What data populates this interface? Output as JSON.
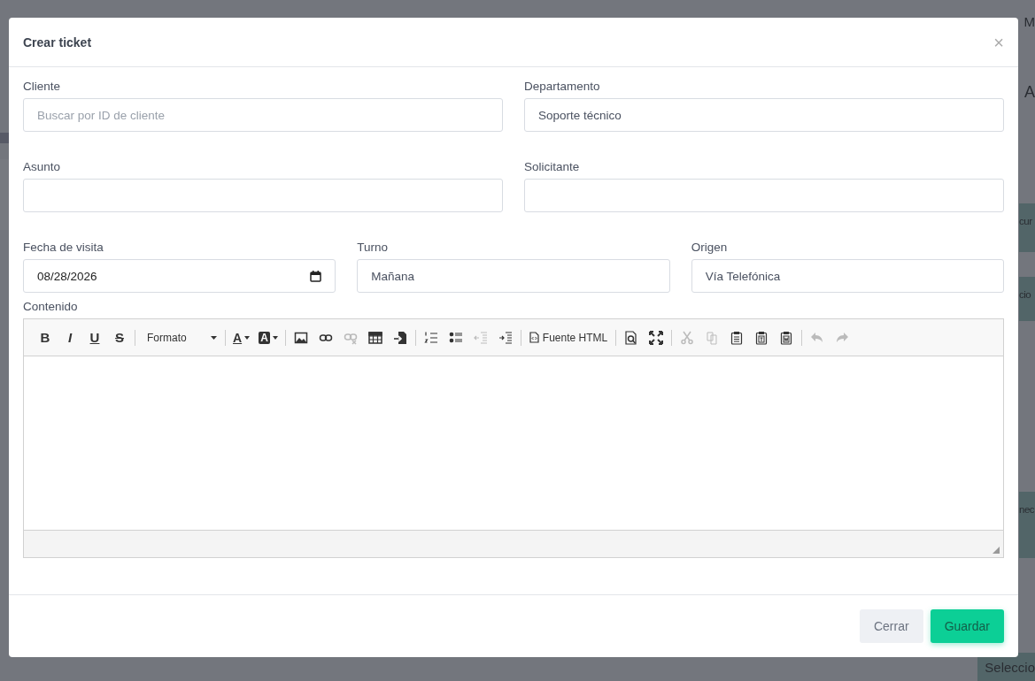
{
  "background": {
    "fragments": [
      {
        "text": "M",
        "kind": "plain"
      },
      {
        "text": "A",
        "kind": "plain"
      },
      {
        "text": "cur",
        "kind": "band"
      },
      {
        "text": "cio",
        "kind": "band"
      },
      {
        "text": "nec",
        "kind": "band"
      },
      {
        "text": "Seleccio",
        "kind": "band"
      }
    ]
  },
  "modal": {
    "title": "Crear ticket",
    "close": "×",
    "rows": [
      [
        {
          "label": "Cliente",
          "placeholder": "Buscar por ID de cliente",
          "kind": "text"
        },
        {
          "label": "Departamento",
          "value": "Soporte técnico",
          "kind": "text"
        }
      ],
      [
        {
          "label": "Asunto",
          "kind": "text"
        },
        {
          "label": "Solicitante",
          "kind": "text"
        }
      ],
      [
        {
          "label": "Fecha de visita",
          "value": "08/28/2026",
          "kind": "date"
        },
        {
          "label": "Turno",
          "value": "Mañana",
          "kind": "text"
        },
        {
          "label": "Origen",
          "value": "Vía Telefónica",
          "kind": "text"
        }
      ]
    ],
    "editor": {
      "label": "Contenido",
      "toolbar": [
        [
          {
            "kind": "char",
            "text": "B",
            "disabled": false
          },
          {
            "kind": "char",
            "text": "I",
            "disabled": false
          },
          {
            "kind": "char",
            "text": "U",
            "disabled": false
          },
          {
            "kind": "char",
            "text": "S",
            "disabled": false
          }
        ],
        [
          {
            "kind": "dropdown",
            "text": "Formato",
            "disabled": false
          }
        ],
        [
          {
            "kind": "color",
            "text": "A",
            "disabled": false
          },
          {
            "kind": "color",
            "text": "A",
            "disabled": false
          }
        ],
        [
          {
            "kind": "image",
            "disabled": false
          },
          {
            "kind": "link",
            "disabled": false
          },
          {
            "kind": "unlink",
            "disabled": true
          },
          {
            "kind": "table",
            "disabled": false
          },
          {
            "kind": "import",
            "disabled": false
          }
        ],
        [
          {
            "kind": "ordered-list",
            "disabled": false
          },
          {
            "kind": "bullet-list",
            "disabled": false
          },
          {
            "kind": "outdent",
            "disabled": true
          },
          {
            "kind": "indent",
            "disabled": false
          }
        ],
        [
          {
            "kind": "source",
            "text": "Fuente HTML",
            "disabled": false
          }
        ],
        [
          {
            "kind": "preview",
            "disabled": false
          },
          {
            "kind": "maximize",
            "disabled": false
          }
        ],
        [
          {
            "kind": "cut",
            "disabled": true
          },
          {
            "kind": "copy",
            "disabled": true
          },
          {
            "kind": "paste",
            "disabled": false
          },
          {
            "kind": "paste-text",
            "disabled": false
          },
          {
            "kind": "paste-word",
            "disabled": false
          }
        ],
        [
          {
            "kind": "undo",
            "disabled": true
          },
          {
            "kind": "redo",
            "disabled": true
          }
        ]
      ]
    },
    "buttons": [
      {
        "label": "Cerrar",
        "kind": "secondary"
      },
      {
        "label": "Guardar",
        "kind": "primary"
      }
    ]
  }
}
